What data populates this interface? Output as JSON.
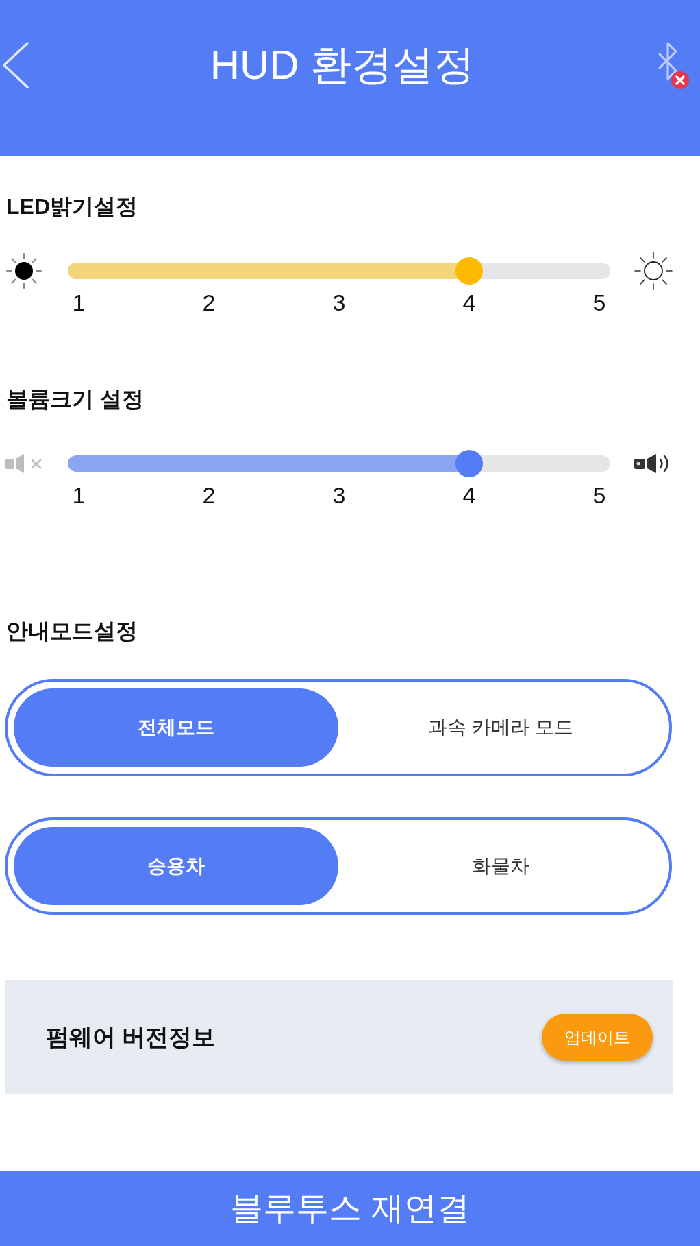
{
  "header": {
    "title": "HUD 환경설정",
    "bluetooth_connected": false
  },
  "sliders": [
    {
      "kind": "brightness",
      "title": "LED밝기설정",
      "level": 0.75,
      "ticks": [
        "1",
        "2",
        "3",
        "4",
        "5"
      ]
    },
    {
      "kind": "volume",
      "title": "볼륨크기 설정",
      "level": 0.75,
      "ticks": [
        "1",
        "2",
        "3",
        "4",
        "5"
      ]
    }
  ],
  "guide_mode": {
    "title": "안내모드설정",
    "toggles": [
      {
        "options": [
          {
            "label": "전체모드",
            "selected": true
          },
          {
            "label": "과속 카메라 모드",
            "selected": false
          }
        ]
      },
      {
        "options": [
          {
            "label": "승용차",
            "selected": true
          },
          {
            "label": "화물차",
            "selected": false
          }
        ]
      }
    ]
  },
  "firmware": {
    "label": "펌웨어 버전정보",
    "button": "업데이트"
  },
  "footer_button": "블루투스 재연결"
}
